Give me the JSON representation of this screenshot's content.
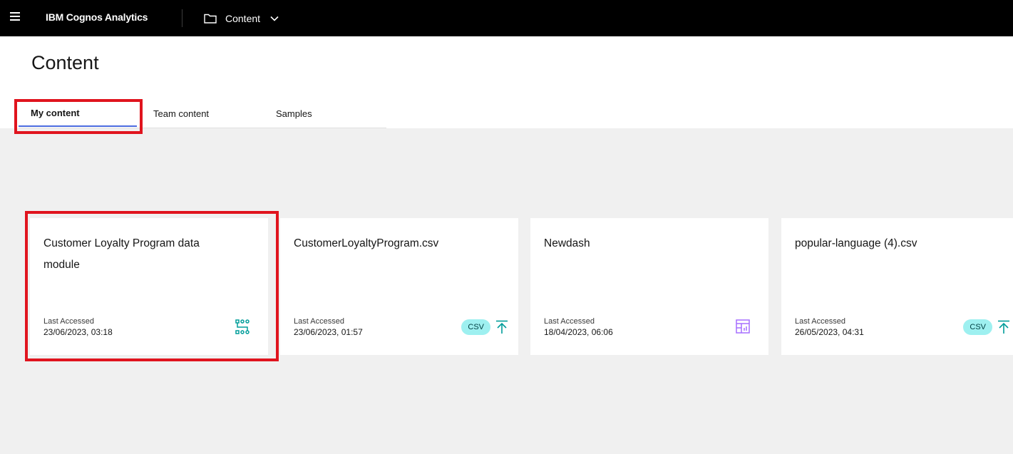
{
  "app": {
    "product_name": "IBM Cognos Analytics",
    "breadcrumb_label": "Content",
    "menu_icon": "hamburger-icon",
    "folder_icon": "folder-icon",
    "chevron_icon": "chevron-down-icon"
  },
  "page": {
    "title": "Content"
  },
  "tabs": [
    {
      "label": "My content",
      "active": true
    },
    {
      "label": "Team content",
      "active": false
    },
    {
      "label": "Samples",
      "active": false
    }
  ],
  "cards": [
    {
      "title": "Customer Loyalty Program data module",
      "meta_label": "Last Accessed",
      "meta_value": "23/06/2023, 03:18",
      "icon": "data-module-icon",
      "badge": ""
    },
    {
      "title": "CustomerLoyaltyProgram.csv",
      "meta_label": "Last Accessed",
      "meta_value": "23/06/2023, 01:57",
      "icon": "upload-icon",
      "badge": "CSV"
    },
    {
      "title": "Newdash",
      "meta_label": "Last Accessed",
      "meta_value": "18/04/2023, 06:06",
      "icon": "dashboard-icon",
      "badge": ""
    },
    {
      "title": "popular-language (4).csv",
      "meta_label": "Last Accessed",
      "meta_value": "26/05/2023, 04:31",
      "icon": "upload-icon",
      "badge": "CSV"
    }
  ],
  "colors": {
    "topbar": "#000000",
    "canvas": "#f0f0f0",
    "highlight": "#e0141e",
    "active_tab": "#4c6ce0",
    "teal_icon": "#009d9a",
    "purple_icon": "#a56eff",
    "csv_badge": "#9ef0f0"
  }
}
